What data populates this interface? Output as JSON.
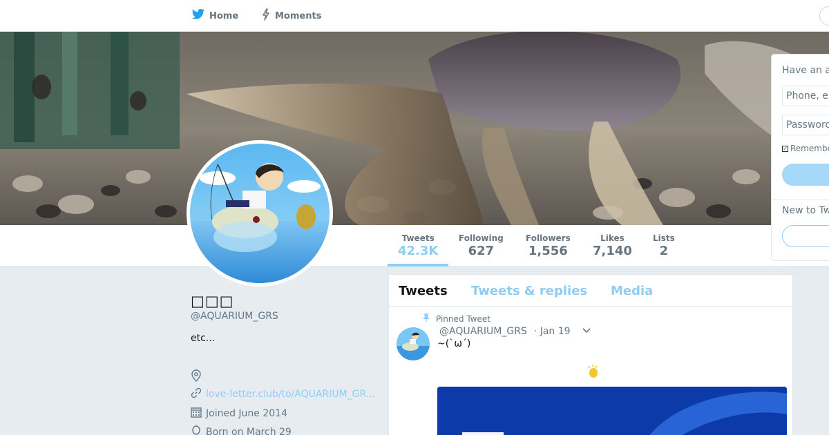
{
  "nav": {
    "home_label": "Home",
    "moments_label": "Moments"
  },
  "colors": {
    "accent": "#8ecdf6",
    "background": "#e6ecf0",
    "text_secondary": "#657786"
  },
  "profile": {
    "display_name": "□□□",
    "handle": "@AQUARIUM_GRS",
    "bio": "etc...",
    "location": "",
    "website": "love-letter.club/to/AQUARIUM_GR...",
    "joined": "Joined June 2014",
    "born": "Born on March 29"
  },
  "stats": [
    {
      "label": "Tweets",
      "value": "42.3K",
      "active": true
    },
    {
      "label": "Following",
      "value": "627",
      "active": false
    },
    {
      "label": "Followers",
      "value": "1,556",
      "active": false
    },
    {
      "label": "Likes",
      "value": "7,140",
      "active": false
    },
    {
      "label": "Lists",
      "value": "2",
      "active": false
    }
  ],
  "login": {
    "title": "Have an account?",
    "phone_placeholder": "Phone, email or username",
    "password_placeholder": "Password",
    "remember_label": "Remember me",
    "new_label": "New to Twitter?"
  },
  "timeline": {
    "tabs": [
      "Tweets",
      "Tweets & replies",
      "Media"
    ],
    "pinned_label": "Pinned Tweet",
    "tweet": {
      "handle": "@AQUARIUM_GRS",
      "date": "· Jan 19",
      "text": "~(`ω´)"
    }
  },
  "icons": [
    "twitter-bird-icon",
    "lightning-icon",
    "location-pin-icon",
    "link-icon",
    "calendar-icon",
    "balloon-icon",
    "pin-icon",
    "chevron-down-icon",
    "clap-emoji-icon"
  ]
}
